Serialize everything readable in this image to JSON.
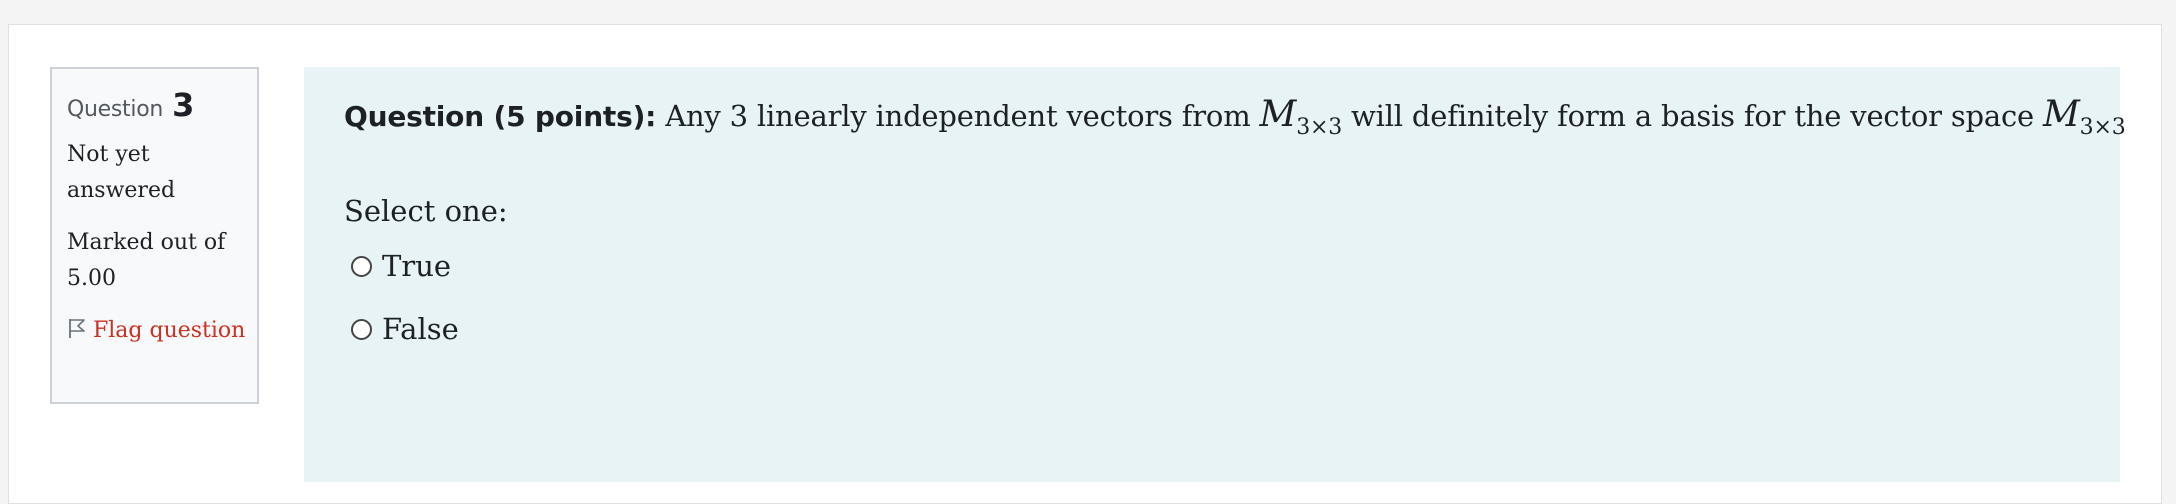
{
  "question_info": {
    "label": "Question",
    "number": "3",
    "state": "Not yet answered",
    "grade": "Marked out of 5.00",
    "flag_label": "Flag question",
    "flag_icon": "flag-outline-icon",
    "flag_color": "#ca3120"
  },
  "question": {
    "prefix": "Question (5 points):",
    "text_part1": " Any 3 linearly independent vectors from ",
    "math_symbol": "M",
    "math_subscript": "3×3",
    "text_part2": " will definitely form a basis for the vector space ",
    "background_color": "#e7f3f5"
  },
  "answers": {
    "prompt": "Select one:",
    "options": [
      {
        "label": "True",
        "selected": false
      },
      {
        "label": "False",
        "selected": false
      }
    ]
  }
}
